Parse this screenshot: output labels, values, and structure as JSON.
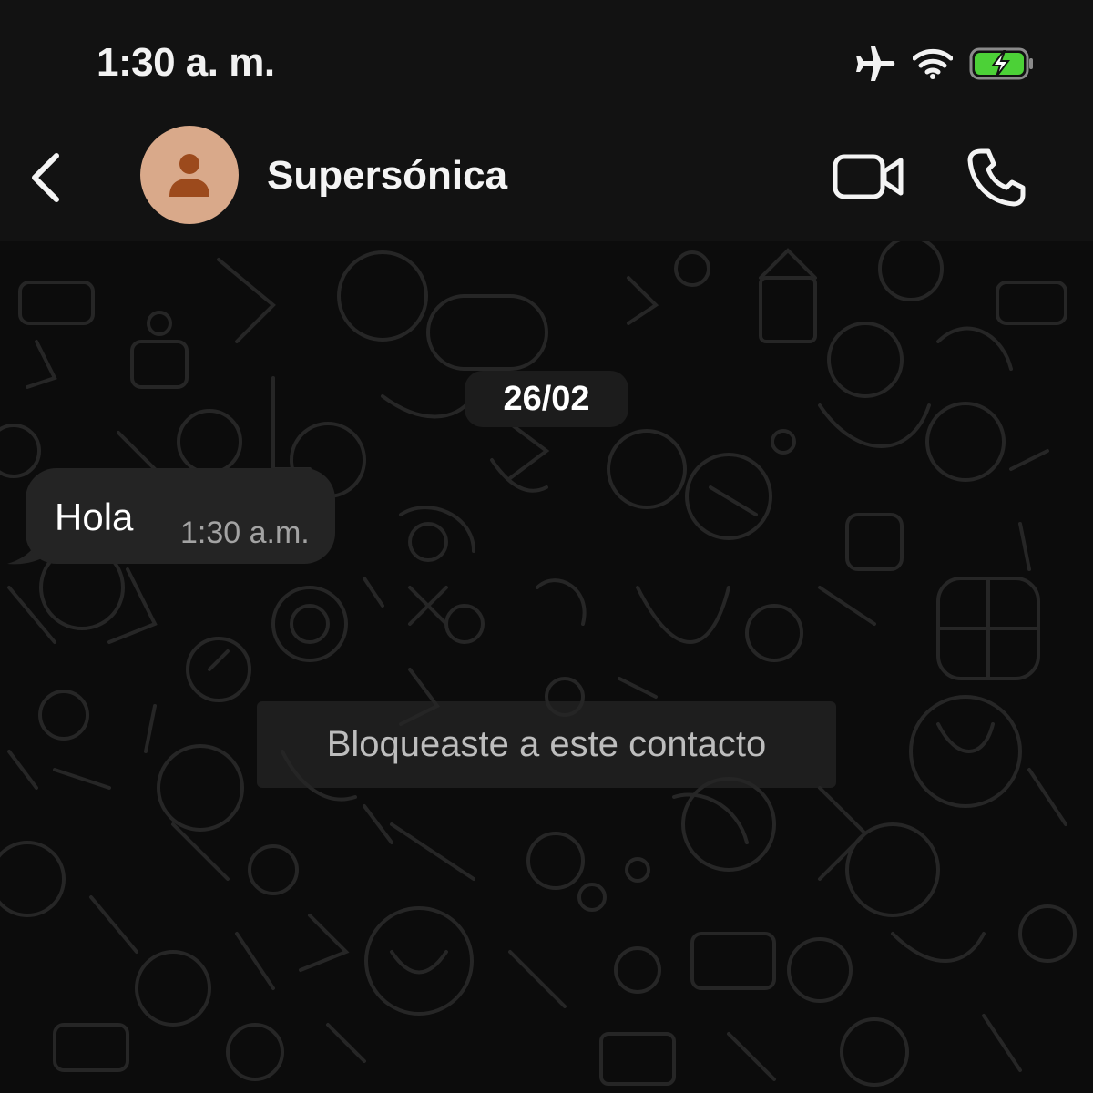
{
  "status_bar": {
    "time": "1:30 a. m.",
    "icons": [
      "airplane-icon",
      "wifi-icon",
      "battery-charging-icon"
    ],
    "battery_color": "#4cd137"
  },
  "header": {
    "contact_name": "Supersónica",
    "avatar_color": "#d9a98a",
    "avatar_icon_color": "#9c4a1c",
    "icons": [
      "chevron-left-icon",
      "video-camera-icon",
      "phone-icon"
    ]
  },
  "chat": {
    "date_chip": "26/02",
    "messages": [
      {
        "text": "Hola",
        "time": "1:30 a.m.",
        "direction": "incoming"
      }
    ],
    "system_notice": "Bloqueaste a este contacto"
  },
  "colors": {
    "background": "#0b0b0b",
    "bar": "#121212",
    "bubble": "#242424",
    "text": "#ffffff",
    "muted": "#a3a3a3"
  }
}
